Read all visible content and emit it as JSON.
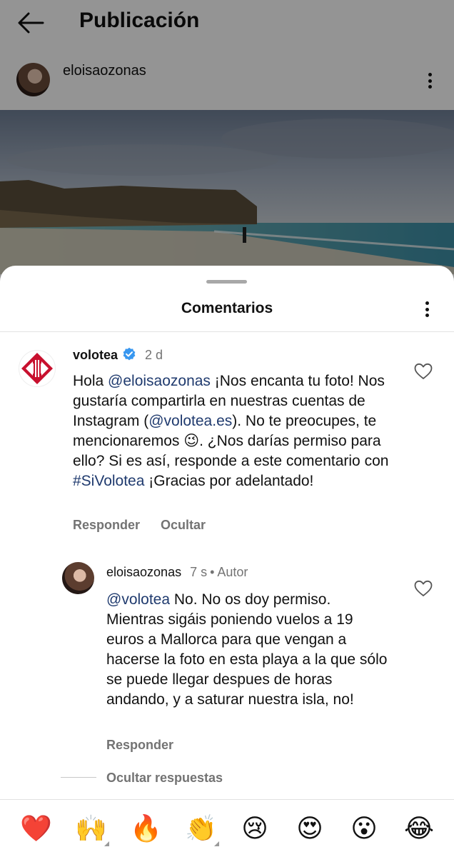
{
  "appbar": {
    "title": "Publicación"
  },
  "post": {
    "username": "eloisaozonas"
  },
  "sheet": {
    "title": "Comentarios"
  },
  "comments": [
    {
      "username": "volotea",
      "time": "2 d",
      "text_segments": [
        {
          "t": "Hola "
        },
        {
          "t": "@eloisaozonas",
          "m": true
        },
        {
          "t": " ¡Nos encanta tu foto! Nos gustaría compartirla en nuestras cuentas de Instagram ("
        },
        {
          "t": "@volotea.es",
          "m": true
        },
        {
          "t": "). No te preocupes, te mencionaremos 😉. ¿Nos darías permiso para ello? Si es así, responde a este comentario con "
        },
        {
          "t": "#SiVolotea",
          "m": true
        },
        {
          "t": " ¡Gracias por adelantado!"
        }
      ],
      "actions": {
        "reply": "Responder",
        "hide": "Ocultar"
      }
    }
  ],
  "reply": {
    "username": "eloisaozonas",
    "time": "7 s",
    "separator": "•",
    "author_label": "Autor",
    "text_segments": [
      {
        "t": "@volotea",
        "m": true
      },
      {
        "t": " No. No os doy permiso. Mientras sigáis poniendo vuelos a 19 euros a Mallorca para que vengan a hacerse la foto en esta playa a la que sólo se puede llegar despues de horas andando, y a saturar nuestra isla, no!"
      }
    ],
    "actions": {
      "reply": "Responder"
    }
  },
  "hide_replies": "Ocultar respuestas",
  "emoji_bar": [
    "❤️",
    "🙌",
    "🔥",
    "👏",
    "😢",
    "😍",
    "😮",
    "😂"
  ],
  "colors": {
    "mention": "#1f3a6e",
    "verified": "#3897f0",
    "volotea_red": "#c8102e",
    "secondary_text": "#737373"
  }
}
